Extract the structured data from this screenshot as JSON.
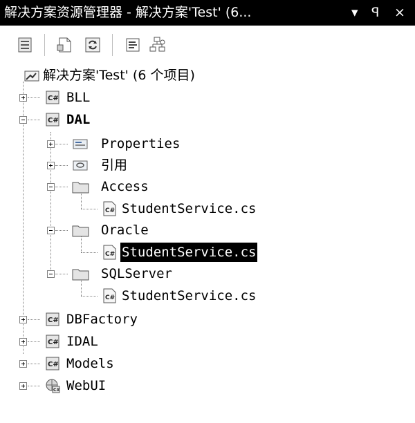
{
  "window": {
    "title": "解决方案资源管理器 - 解决方案'Test' (6...",
    "dropdown_glyph": "▾",
    "pin_glyph": "ꟼ",
    "close_glyph": "×"
  },
  "toolbar": {
    "buttons": [
      {
        "name": "properties-button",
        "icon": "properties-icon"
      },
      {
        "name": "show-all-files-button",
        "icon": "show-all-files-icon"
      },
      {
        "name": "refresh-button",
        "icon": "refresh-icon"
      },
      {
        "name": "view-code-button",
        "icon": "view-code-icon"
      },
      {
        "name": "class-diagram-button",
        "icon": "class-diagram-icon"
      }
    ]
  },
  "tree": {
    "solution": "解决方案'Test' (6 个项目)",
    "bll": "BLL",
    "dal": "DAL",
    "properties": "Properties",
    "references": "引用",
    "access": "Access",
    "access_file": "StudentService.cs",
    "oracle": "Oracle",
    "oracle_file": "StudentService.cs",
    "sqlserver": "SQLServer",
    "sqlserver_file": "StudentService.cs",
    "dbfactory": "DBFactory",
    "idal": "IDAL",
    "models": "Models",
    "webui": "WebUI"
  },
  "colors": {
    "title_bg": "#000000",
    "selection_bg": "#000000",
    "selection_fg": "#ffffff"
  }
}
